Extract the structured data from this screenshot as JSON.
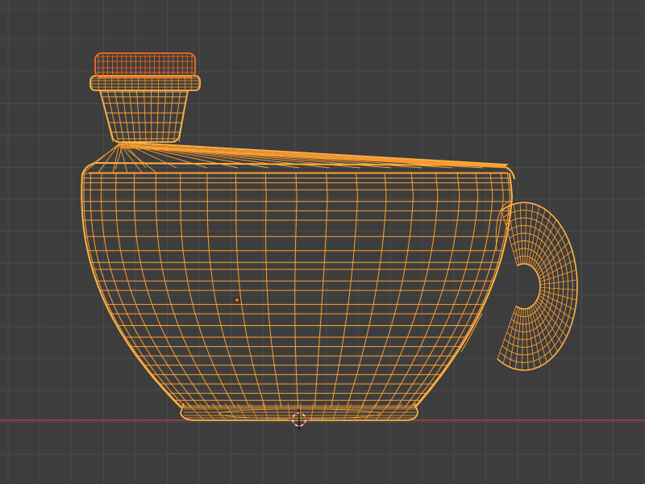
{
  "viewport": {
    "background": "#3d3d3d",
    "grid_color": "#4a4a4a",
    "x_axis_color": "#c83c46",
    "wire_color": "#ff9f2e",
    "wire_highlight": "#ffb347",
    "active_color": "#ff6a1a",
    "origin_color": "#ff5a00",
    "cursor_colors": [
      "#ffffff",
      "#e04040"
    ]
  },
  "scene": {
    "selected_object": "teacup-with-spout",
    "mode": "wireframe"
  }
}
